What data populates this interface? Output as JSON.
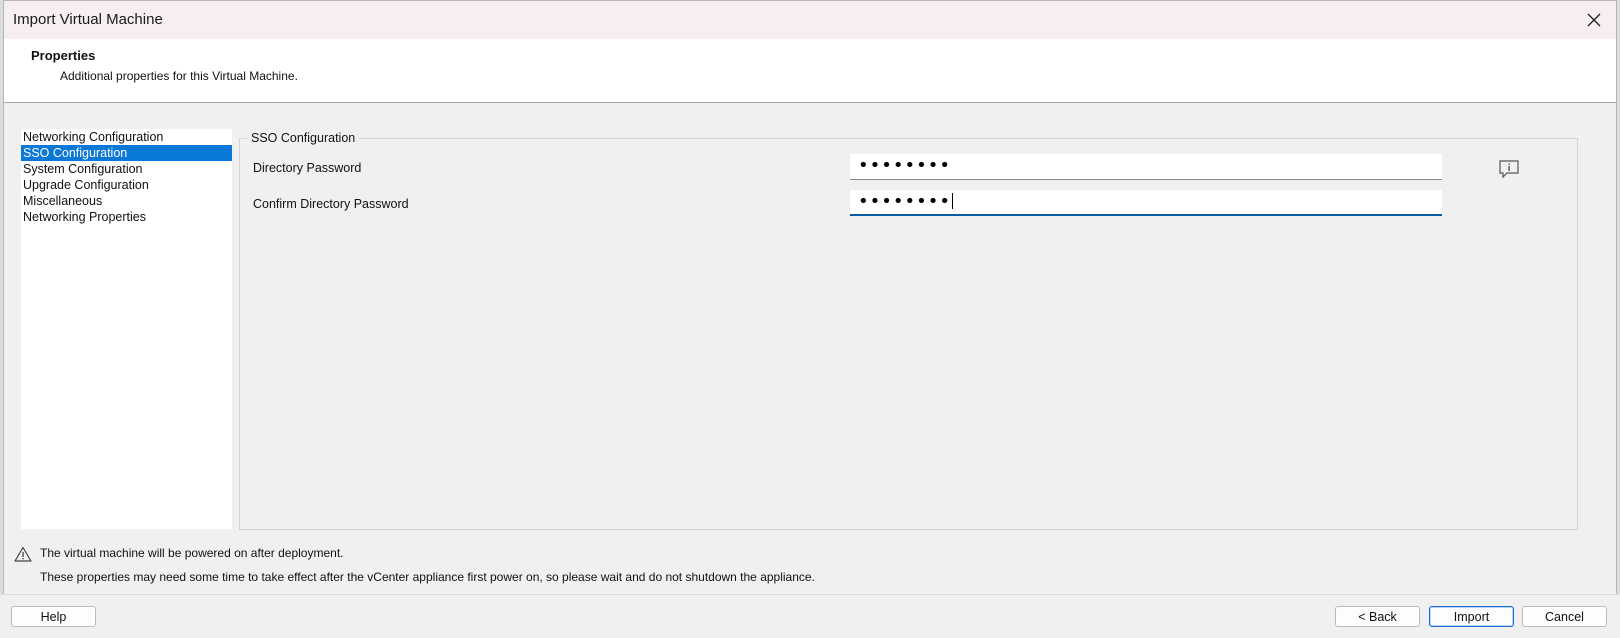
{
  "window": {
    "title": "Import Virtual Machine"
  },
  "header": {
    "title": "Properties",
    "subtitle": "Additional properties for this Virtual Machine."
  },
  "nav": {
    "items": [
      {
        "label": "Networking Configuration",
        "selected": false
      },
      {
        "label": "SSO Configuration",
        "selected": true
      },
      {
        "label": "System Configuration",
        "selected": false
      },
      {
        "label": "Upgrade Configuration",
        "selected": false
      },
      {
        "label": "Miscellaneous",
        "selected": false
      },
      {
        "label": "Networking Properties",
        "selected": false
      }
    ]
  },
  "sso": {
    "legend": "SSO Configuration",
    "directory_password_label": "Directory Password",
    "directory_password_value": "••••••••",
    "confirm_password_label": "Confirm Directory Password",
    "confirm_password_value": "••••••••"
  },
  "footer": {
    "warning": "The virtual machine will be powered on after deployment.",
    "note": "These properties may need some time to take effect after the vCenter appliance first power on, so please wait and do not shutdown the appliance."
  },
  "buttons": {
    "help": "Help",
    "back": "< Back",
    "import": "Import",
    "cancel": "Cancel"
  },
  "icons": {
    "close": "close-icon",
    "info": "info-icon",
    "warning": "warning-icon"
  },
  "colors": {
    "selection": "#0a78d7",
    "focus_underline": "#0a5aa8",
    "default_button_border": "#1c6ad0"
  }
}
